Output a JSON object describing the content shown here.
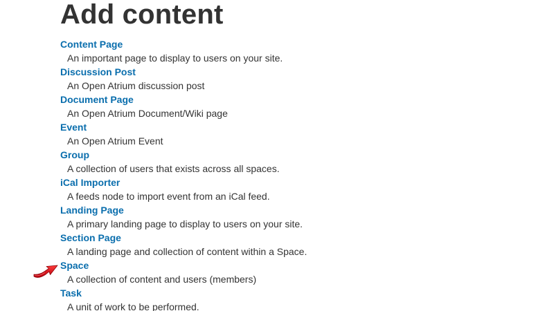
{
  "page": {
    "title": "Add content"
  },
  "content_types": [
    {
      "name": "Content Page",
      "description": "An important page to display to users on your site."
    },
    {
      "name": "Discussion Post",
      "description": "An Open Atrium discussion post"
    },
    {
      "name": "Document Page",
      "description": "An Open Atrium Document/Wiki page"
    },
    {
      "name": "Event",
      "description": "An Open Atrium Event"
    },
    {
      "name": "Group",
      "description": "A collection of users that exists across all spaces."
    },
    {
      "name": "iCal Importer",
      "description": "A feeds node to import event from an iCal feed."
    },
    {
      "name": "Landing Page",
      "description": "A primary landing page to display to users on your site."
    },
    {
      "name": "Section Page",
      "description": "A landing page and collection of content within a Space."
    },
    {
      "name": "Space",
      "description": "A collection of content and users (members)"
    },
    {
      "name": "Task",
      "description": "A unit of work to be performed."
    }
  ],
  "annotation": {
    "icon": "red-pointer-arrow-icon",
    "color": "#e0101a",
    "points_to": "Space"
  },
  "colors": {
    "link": "#0a6ead",
    "text": "#333333",
    "title": "#333333",
    "background": "#ffffff"
  }
}
